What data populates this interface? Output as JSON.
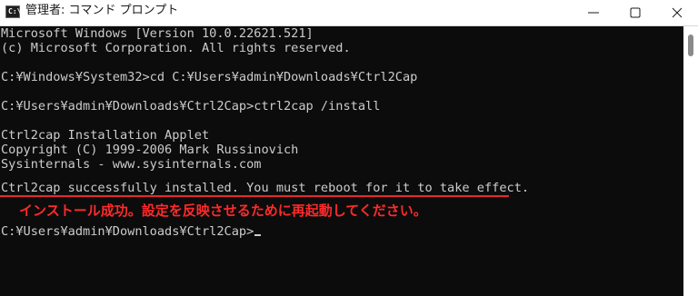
{
  "window": {
    "title": "管理者: コマンド プロンプト",
    "icon": "command-prompt-icon"
  },
  "titlebar_controls": {
    "minimize_icon": "minimize-icon",
    "maximize_icon": "maximize-icon",
    "close_icon": "close-icon"
  },
  "console": {
    "lines": [
      "Microsoft Windows [Version 10.0.22621.521]",
      "(c) Microsoft Corporation. All rights reserved.",
      "",
      "C:¥Windows¥System32>cd C:¥Users¥admin¥Downloads¥Ctrl2Cap",
      "",
      "C:¥Users¥admin¥Downloads¥Ctrl2Cap>ctrl2cap /install",
      "",
      "Ctrl2cap Installation Applet",
      "Copyright (C) 1999-2006 Mark Russinovich",
      "Sysinternals - www.sysinternals.com",
      "",
      "Ctrl2cap successfully installed. You must reboot for it to take effect."
    ],
    "prompt": "C:¥Users¥admin¥Downloads¥Ctrl2Cap>"
  },
  "annotation": {
    "text": "インストール成功。設定を反映させるために再起動してください。",
    "color": "#ff2a2a"
  },
  "colors": {
    "console_bg": "#0c0c0c",
    "console_fg": "#cccccc",
    "underline": "#e8282b"
  }
}
